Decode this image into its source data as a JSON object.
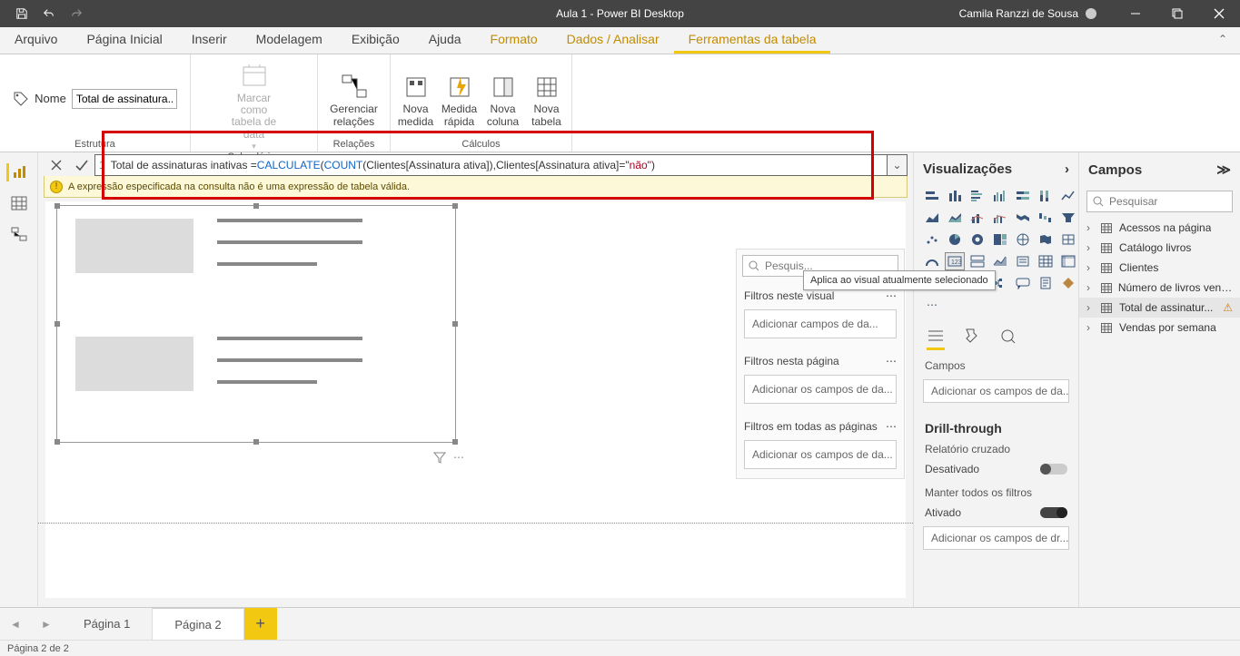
{
  "titlebar": {
    "title": "Aula 1 - Power BI Desktop",
    "user": "Camila Ranzzi de Sousa"
  },
  "menu": {
    "items": [
      "Arquivo",
      "Página Inicial",
      "Inserir",
      "Modelagem",
      "Exibição",
      "Ajuda",
      "Formato",
      "Dados / Analisar",
      "Ferramentas da tabela"
    ],
    "active_index": 8
  },
  "ribbon": {
    "name_label": "Nome",
    "name_value": "Total de assinatura...",
    "group_estrutura": "Estrutura",
    "mark_date_table": "Marcar como tabela de data",
    "group_calendarios": "Calendários",
    "manage_relations": "Gerenciar relações",
    "group_relacoes": "Relações",
    "new_measure": "Nova medida",
    "quick_measure": "Medida rápida",
    "new_column": "Nova coluna",
    "new_table": "Nova tabela",
    "group_calculos": "Cálculos"
  },
  "formula": {
    "line_no": "1",
    "plain_prefix": " Total de assinaturas inativas = ",
    "kw1": "CALCULATE",
    "p1": "(",
    "kw2": "COUNT",
    "p2": "(Clientes[Assinatura ativa]),Clientes[Assinatura ativa]=",
    "str": "\"não\"",
    "p3": ")",
    "error": "A expressão especificada na consulta não é uma expressão de tabela válida."
  },
  "filters": {
    "search_placeholder": "Pesquis...",
    "visual_header": "Filtros neste visual",
    "visual_drop": "Adicionar campos de da...",
    "page_header": "Filtros nesta página",
    "page_drop": "Adicionar os campos de da...",
    "all_header": "Filtros em todas as páginas",
    "all_drop": "Adicionar os campos de da..."
  },
  "tooltip": "Aplica ao visual atualmente selecionado",
  "vis": {
    "title": "Visualizações",
    "fields_label": "Campos",
    "fields_drop": "Adicionar os campos de da...",
    "drill_title": "Drill-through",
    "cross_label": "Relatório cruzado",
    "cross_state": "Desativado",
    "keep_label": "Manter todos os filtros",
    "keep_state": "Ativado",
    "drill_drop": "Adicionar os campos de dr..."
  },
  "fields": {
    "title": "Campos",
    "search_placeholder": "Pesquisar",
    "tables": [
      {
        "name": "Acessos na página",
        "type": "table"
      },
      {
        "name": "Catálogo livros",
        "type": "table"
      },
      {
        "name": "Clientes",
        "type": "table"
      },
      {
        "name": "Número de livros vendi...",
        "type": "table"
      },
      {
        "name": "Total de assinatur...",
        "type": "table-error",
        "selected": true
      },
      {
        "name": "Vendas por semana",
        "type": "table"
      }
    ]
  },
  "pagetabs": {
    "tabs": [
      "Página 1",
      "Página 2"
    ],
    "active_index": 1
  },
  "status": "Página 2 de 2"
}
